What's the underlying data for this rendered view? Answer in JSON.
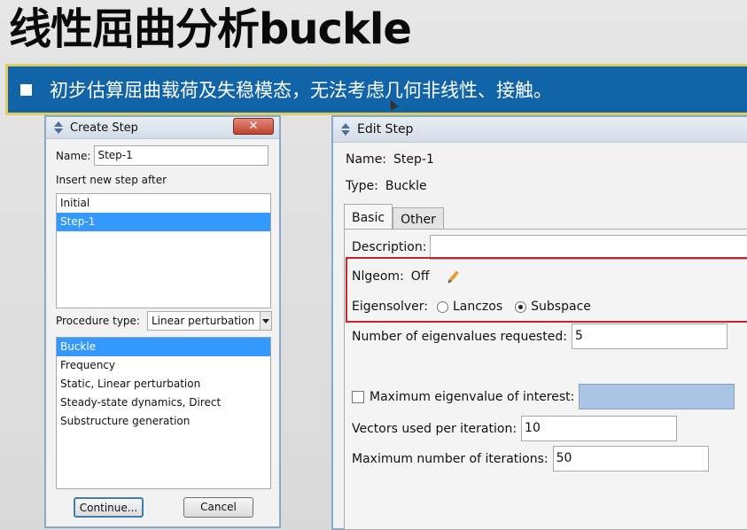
{
  "slide": {
    "title": "线性屈曲分析buckle",
    "banner_text": "初步估算屈曲载荷及失稳模态，无法考虑几何非线性、接触。",
    "accent_color": "#1264a8",
    "banner_border_color": "#e1cc63"
  },
  "create_step": {
    "title": "Create Step",
    "name_label": "Name:",
    "name_value": "Step-1",
    "insert_label": "Insert new step after",
    "steps": [
      "Initial",
      "Step-1"
    ],
    "selected_step": "Step-1",
    "procedure_label": "Procedure type:",
    "procedure_value": "Linear perturbation",
    "procedures": [
      "Buckle",
      "Frequency",
      "Static, Linear perturbation",
      "Steady-state dynamics, Direct",
      "Substructure generation"
    ],
    "selected_procedure": "Buckle",
    "continue_label": "Continue...",
    "cancel_label": "Cancel",
    "close_icon": "close-icon"
  },
  "edit_step": {
    "title": "Edit Step",
    "name_label": "Name:",
    "name_value": "Step-1",
    "type_label": "Type:",
    "type_value": "Buckle",
    "tabs": [
      "Basic",
      "Other"
    ],
    "active_tab": "Basic",
    "description_label": "Description:",
    "description_value": "",
    "nlgeom_label": "Nlgeom:",
    "nlgeom_value": "Off",
    "eigensolver_label": "Eigensolver:",
    "eigensolver_options": [
      "Lanczos",
      "Subspace"
    ],
    "eigensolver_selected": "Subspace",
    "num_eigen_label": "Number of eigenvalues requested:",
    "num_eigen_value": "5",
    "max_eigen_label": "Maximum eigenvalue of interest:",
    "max_eigen_checked": false,
    "vectors_label": "Vectors used per iteration:",
    "vectors_value": "10",
    "max_iter_label": "Maximum number of iterations:",
    "max_iter_value": "50",
    "highlight_color": "#c62828"
  }
}
